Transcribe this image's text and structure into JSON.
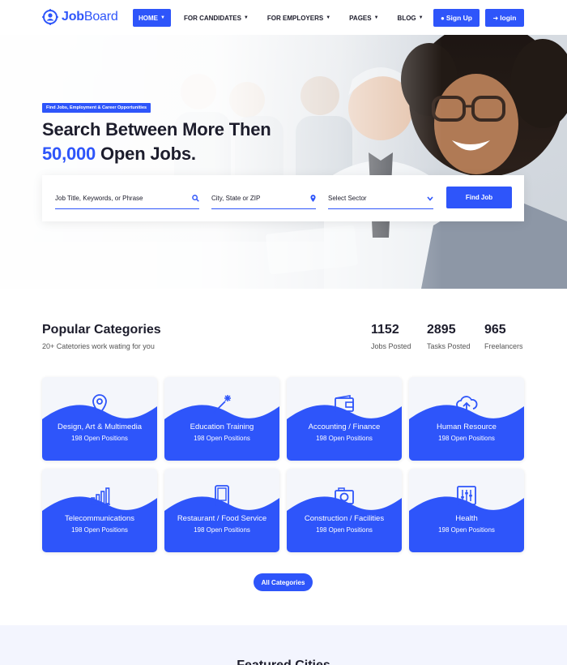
{
  "header": {
    "logo_text_bold": "Job",
    "logo_text": "Board",
    "nav": [
      {
        "label": "HOME",
        "active": true
      },
      {
        "label": "FOR CANDIDATES",
        "active": false
      },
      {
        "label": "FOR EMPLOYERS",
        "active": false
      },
      {
        "label": "PAGES",
        "active": false
      },
      {
        "label": "BLOG",
        "active": false
      }
    ],
    "signup_label": "Sign Up",
    "login_label": "login"
  },
  "hero": {
    "tag": "Find Jobs, Employment & Career Opportunities",
    "title_line1": "Search Between More Then",
    "title_highlight": "50,000",
    "title_line2_rest": " Open Jobs.",
    "search": {
      "keyword_placeholder": "Job Title, Keywords, or Phrase",
      "location_placeholder": "City, State or ZIP",
      "sector_selected": "Select Sector",
      "button_label": "Find Job"
    }
  },
  "categories": {
    "title": "Popular Categories",
    "subtitle": "20+ Catetories work wating for you",
    "stats": [
      {
        "value": "1152",
        "label": "Jobs Posted"
      },
      {
        "value": "2895",
        "label": "Tasks Posted"
      },
      {
        "value": "965",
        "label": "Freelancers"
      }
    ],
    "items": [
      {
        "name": "Design, Art & Multimedia",
        "positions": "198 Open Positions",
        "icon": "location-pin-icon"
      },
      {
        "name": "Education Training",
        "positions": "198 Open Positions",
        "icon": "magic-wand-icon"
      },
      {
        "name": "Accounting / Finance",
        "positions": "198 Open Positions",
        "icon": "wallet-icon"
      },
      {
        "name": "Human Resource",
        "positions": "198 Open Positions",
        "icon": "cloud-upload-icon"
      },
      {
        "name": "Telecommunications",
        "positions": "198 Open Positions",
        "icon": "signal-bars-icon"
      },
      {
        "name": "Restaurant / Food Service",
        "positions": "198 Open Positions",
        "icon": "tablet-icon"
      },
      {
        "name": "Construction / Facilities",
        "positions": "198 Open Positions",
        "icon": "camera-icon"
      },
      {
        "name": "Health",
        "positions": "198 Open Positions",
        "icon": "equalizer-icon"
      }
    ],
    "all_button": "All Categories"
  },
  "featured": {
    "title": "Featured Cities"
  },
  "colors": {
    "accent": "#2e55fa",
    "text": "#1d1d2c",
    "card_bg": "#f4f6fb"
  }
}
